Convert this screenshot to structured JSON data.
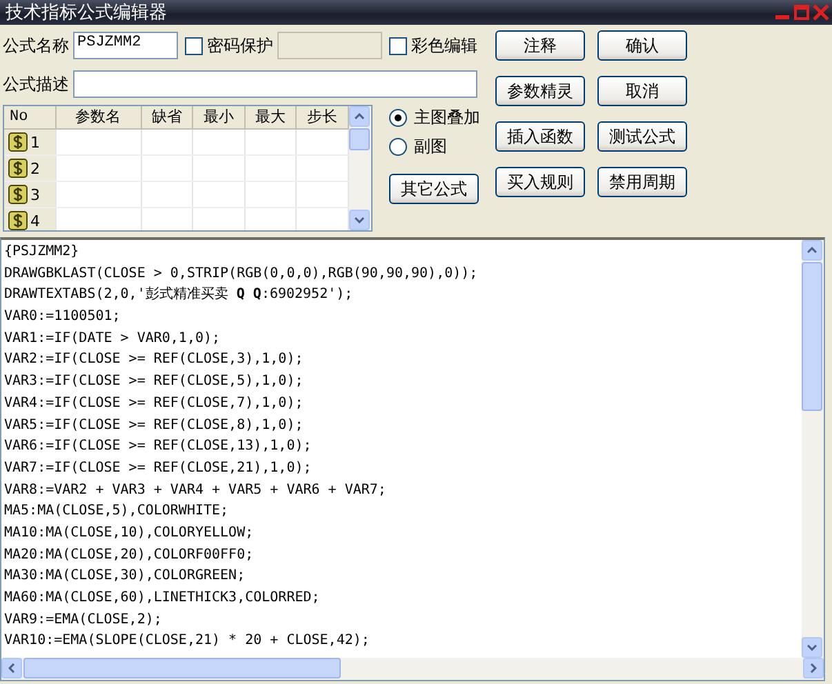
{
  "window": {
    "title": "技术指标公式编辑器"
  },
  "form": {
    "name_label": "公式名称",
    "name_value": "PSJZMM2",
    "password_checkbox": {
      "label": "密码保护",
      "checked": false
    },
    "password_field": {
      "disabled": true
    },
    "color_checkbox": {
      "label": "彩色编辑",
      "checked": false
    },
    "description_label": "公式描述"
  },
  "param_table": {
    "columns": [
      "No",
      "参数名",
      "缺省",
      "最小",
      "最大",
      "步长"
    ],
    "rows": [
      {
        "no": "1"
      },
      {
        "no": "2"
      },
      {
        "no": "3"
      },
      {
        "no": "4"
      }
    ]
  },
  "chart_mode": [
    {
      "label": "主图叠加",
      "selected": true
    },
    {
      "label": "副图",
      "selected": false
    }
  ],
  "other_button": "其它公式",
  "buttons": [
    "注释",
    "确认",
    "参数精灵",
    "取消",
    "插入函数",
    "测试公式",
    "买入规则",
    "禁用周期"
  ],
  "code_lines": [
    "{PSJZMM2}",
    "DRAWGBKLAST(CLOSE > 0,STRIP(RGB(0,0,0),RGB(90,90,90),0));",
    "DRAWTEXTABS(2,0,'彭式精准买卖 **Q Q**:6902952');",
    "VAR0:=1100501;",
    "VAR1:=IF(DATE > VAR0,1,0);",
    "VAR2:=IF(CLOSE >= REF(CLOSE,3),1,0);",
    "VAR3:=IF(CLOSE >= REF(CLOSE,5),1,0);",
    "VAR4:=IF(CLOSE >= REF(CLOSE,7),1,0);",
    "VAR5:=IF(CLOSE >= REF(CLOSE,8),1,0);",
    "VAR6:=IF(CLOSE >= REF(CLOSE,13),1,0);",
    "VAR7:=IF(CLOSE >= REF(CLOSE,21),1,0);",
    "VAR8:=VAR2 + VAR3 + VAR4 + VAR5 + VAR6 + VAR7;",
    "MA5:MA(CLOSE,5),COLORWHITE;",
    "MA10:MA(CLOSE,10),COLORYELLOW;",
    "MA20:MA(CLOSE,20),COLORF00FF0;",
    "MA30:MA(CLOSE,30),COLORGREEN;",
    "MA60:MA(CLOSE,60),LINETHICK3,COLORRED;",
    "VAR9:=EMA(CLOSE,2);",
    "VAR10:=EMA(SLOPE(CLOSE,21) * 20 + CLOSE,42);"
  ]
}
